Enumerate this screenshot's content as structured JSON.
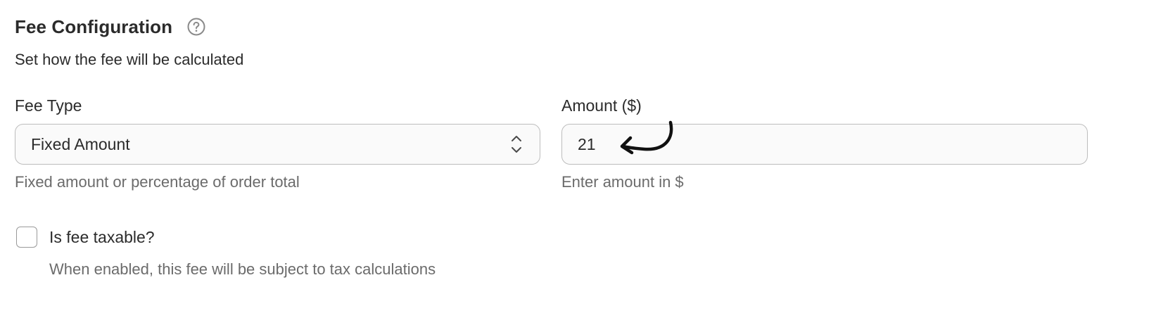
{
  "section": {
    "title": "Fee Configuration",
    "help_icon": "question-circle-icon",
    "subtitle": "Set how the fee will be calculated"
  },
  "fee_type": {
    "label": "Fee Type",
    "selected": "Fixed Amount",
    "helper": "Fixed amount or percentage of order total",
    "icon": "chevron-up-down-icon"
  },
  "amount": {
    "label": "Amount ($)",
    "value": "21",
    "helper": "Enter amount in $"
  },
  "taxable": {
    "label": "Is fee taxable?",
    "checked": false,
    "helper": "When enabled, this fee will be subject to tax calculations"
  },
  "annotation": {
    "icon": "curved-arrow-icon"
  },
  "colors": {
    "text": "#2b2b2b",
    "muted": "#6b6b6b",
    "border": "#bdbdbd",
    "input_bg": "#fafafa"
  }
}
